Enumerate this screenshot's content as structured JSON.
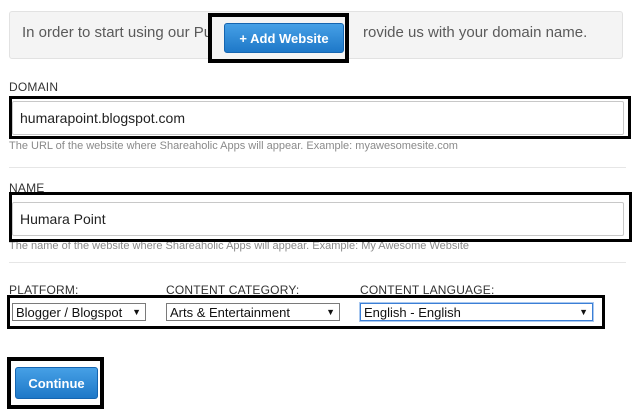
{
  "banner": {
    "text_left": "In order to start using our Pu",
    "text_right": "rovide us with your domain name.",
    "add_button_label": "+ Add Website"
  },
  "domain": {
    "label": "DOMAIN",
    "value": "humarapoint.blogspot.com",
    "hint": "The URL of the website where Shareaholic Apps will appear. Example: myawesomesite.com"
  },
  "name": {
    "label": "NAME",
    "value": "Humara Point",
    "hint": "The name of the website where Shareaholic Apps will appear. Example: My Awesome Website"
  },
  "platform": {
    "label": "PLATFORM:",
    "selected": "Blogger / Blogspot"
  },
  "content_category": {
    "label": "CONTENT CATEGORY:",
    "selected": "Arts & Entertainment"
  },
  "content_language": {
    "label": "CONTENT LANGUAGE:",
    "selected": "English - English"
  },
  "continue_label": "Continue"
}
